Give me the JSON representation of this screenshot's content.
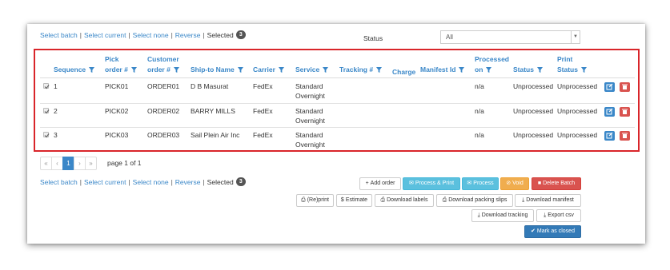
{
  "selection_bar": {
    "select_batch": "Select batch",
    "select_current": "Select current",
    "select_none": "Select none",
    "reverse": "Reverse",
    "selected_label": "Selected",
    "selected_count": "3",
    "separator": "|"
  },
  "status_filter": {
    "label": "Status",
    "value": "All"
  },
  "table": {
    "headers": {
      "sequence": "Sequence",
      "pick_order_1": "Pick",
      "pick_order_2": "order #",
      "customer_order_1": "Customer",
      "customer_order_2": "order #",
      "ship_to_name": "Ship-to Name",
      "carrier": "Carrier",
      "service": "Service",
      "tracking": "Tracking #",
      "charge": "Charge",
      "manifest_id": "Manifest Id",
      "processed_on_1": "Processed",
      "processed_on_2": "on",
      "status": "Status",
      "print_status_1": "Print",
      "print_status_2": "Status"
    },
    "rows": [
      {
        "sequence": "1",
        "pick_order": "PICK01",
        "customer_order": "ORDER01",
        "ship_to": "D B Masurat",
        "carrier": "FedEx",
        "service_1": "Standard",
        "service_2": "Overnight",
        "tracking": "",
        "charge": "",
        "manifest_id": "",
        "processed_on": "n/a",
        "status": "Unprocessed",
        "print_status": "Unprocessed"
      },
      {
        "sequence": "2",
        "pick_order": "PICK02",
        "customer_order": "ORDER02",
        "ship_to": "BARRY MILLS",
        "carrier": "FedEx",
        "service_1": "Standard",
        "service_2": "Overnight",
        "tracking": "",
        "charge": "",
        "manifest_id": "",
        "processed_on": "n/a",
        "status": "Unprocessed",
        "print_status": "Unprocessed"
      },
      {
        "sequence": "3",
        "pick_order": "PICK03",
        "customer_order": "ORDER03",
        "ship_to": "Sail Plein Air Inc",
        "carrier": "FedEx",
        "service_1": "Standard",
        "service_2": "Overnight",
        "tracking": "",
        "charge": "",
        "manifest_id": "",
        "processed_on": "n/a",
        "status": "Unprocessed",
        "print_status": "Unprocessed"
      }
    ]
  },
  "pagination": {
    "first": "«",
    "prev": "‹",
    "current": "1",
    "next": "›",
    "last": "»",
    "page_of": "page 1 of 1"
  },
  "actions": {
    "add_order": "Add order",
    "process_print": "Process & Print",
    "process": "Process",
    "void": "Void",
    "delete_batch": "Delete Batch",
    "reprint": "(Re)print",
    "estimate": "Estimate",
    "download_labels": "Download labels",
    "download_packing_slips": "Download packing slips",
    "download_manifest": "Download manifest",
    "download_tracking": "Download tracking",
    "export_csv": "Export csv",
    "mark_as_closed": "Mark as closed"
  },
  "colors": {
    "link": "#3a87c8",
    "highlight_border": "#d9252a",
    "edit_button": "#3a87c8",
    "delete_button": "#d9534f",
    "teal_button": "#5bc0de",
    "void_button": "#f0ad4e",
    "primary_button": "#337ab7"
  },
  "icons": {
    "filter": "funnel-icon",
    "edit": "edit-icon",
    "delete": "trash-icon",
    "add": "plus-icon",
    "email": "envelope-icon",
    "void": "ban-icon",
    "print": "printer-icon",
    "download": "download-icon",
    "check": "check-circle-icon"
  }
}
